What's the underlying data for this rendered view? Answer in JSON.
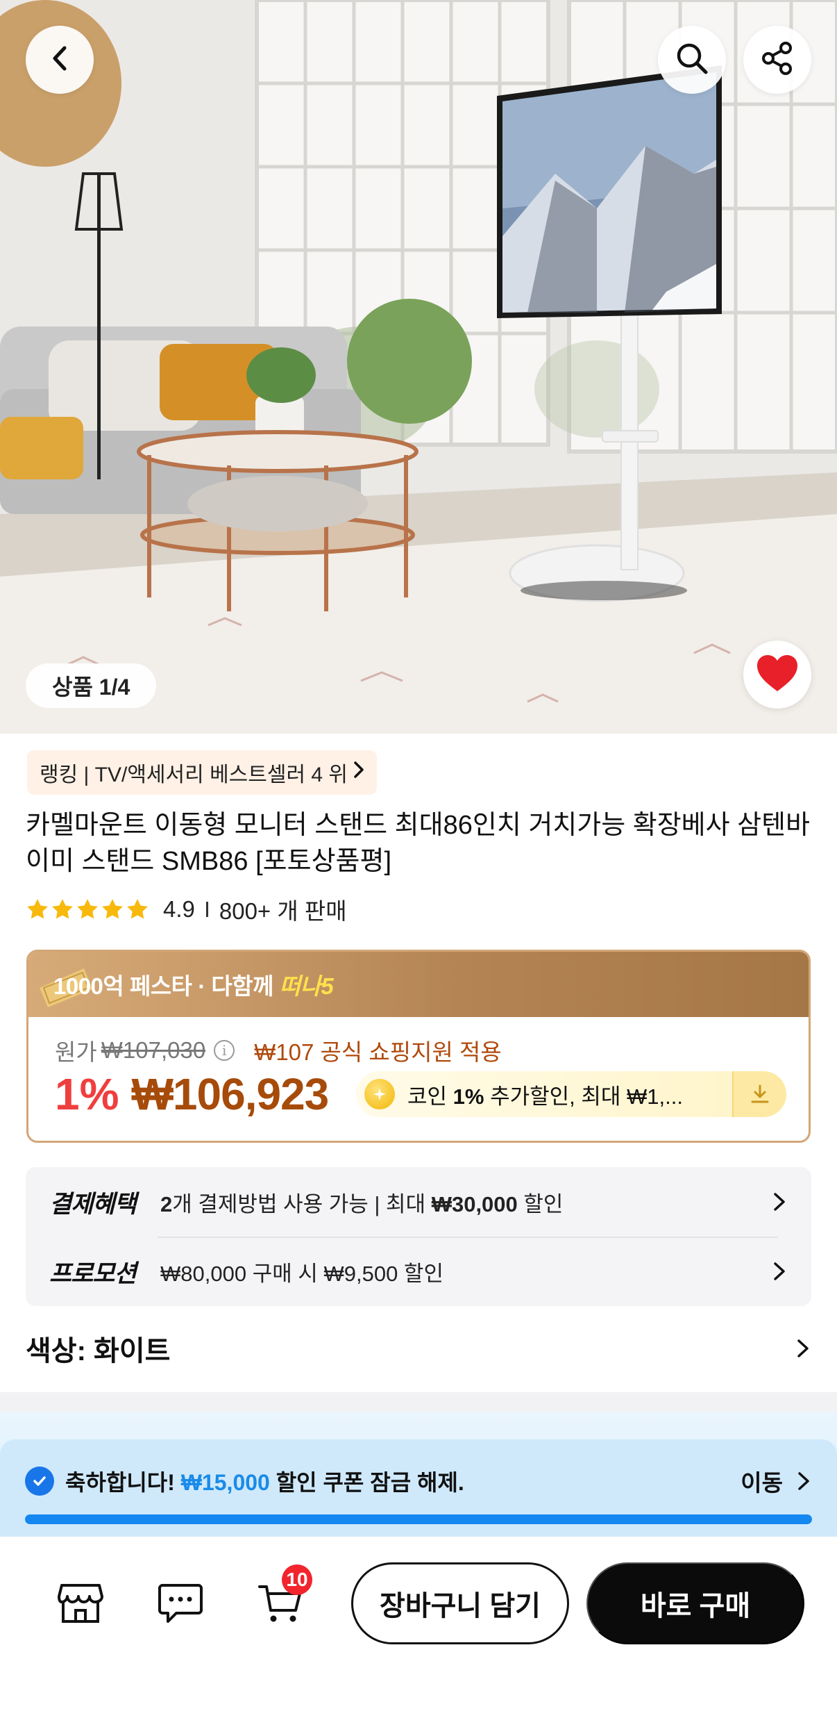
{
  "hero": {
    "image_counter": "상품 1/4",
    "liked": true
  },
  "icons": {
    "back": "chevron-left-icon",
    "search": "search-icon",
    "share": "share-icon",
    "like": "heart-icon",
    "store": "store-icon",
    "chat": "chat-icon",
    "cart": "cart-icon"
  },
  "product": {
    "ranking": "랭킹 | TV/액세서리 베스트셀러 4 위",
    "title": "카멜마운트 이동형 모니터 스탠드 최대86인치 거치가능 확장베사 삼텐바이미 스탠드 SMB86 [포토상품평]",
    "rating": "4.9",
    "stars": 5,
    "sold": "800+ 개 판매"
  },
  "price": {
    "festival_prefix": "1000억 페스타 · 다함께 ",
    "festival_highlight": "떠나5",
    "original_label": "원가",
    "original_price": "₩107,030",
    "support_text": "₩107 공식 쇼핑지원 적용",
    "discount": "1%",
    "final_price": "₩106,923",
    "coin_prefix": "코인 ",
    "coin_bold": "1%",
    "coin_suffix": " 추가할인, 최대 ₩1,..."
  },
  "benefits": [
    {
      "label": "결제혜택",
      "text_bold_1": "2",
      "text_mid": "개 결제방법 사용 가능 | 최대 ",
      "text_bold_2": "₩30,000",
      "text_end": " 할인"
    },
    {
      "label": "프로모션",
      "text": "₩80,000 구매 시 ₩9,500 할인"
    }
  ],
  "option": {
    "color": "색상: 화이트"
  },
  "coupon": {
    "prefix": "축하합니다! ",
    "amount": "₩15,000",
    "suffix": " 할인 쿠폰 잠금 해제.",
    "action": "이동",
    "progress": 1.0
  },
  "bottom": {
    "cart_count": "10",
    "add_to_cart": "장바구니 담기",
    "buy_now": "바로 구매"
  },
  "colors": {
    "accent_red": "#f03e3e",
    "price_brown": "#a64b0a",
    "coupon_blue": "#1a8be8",
    "heart_red": "#e8202a"
  }
}
